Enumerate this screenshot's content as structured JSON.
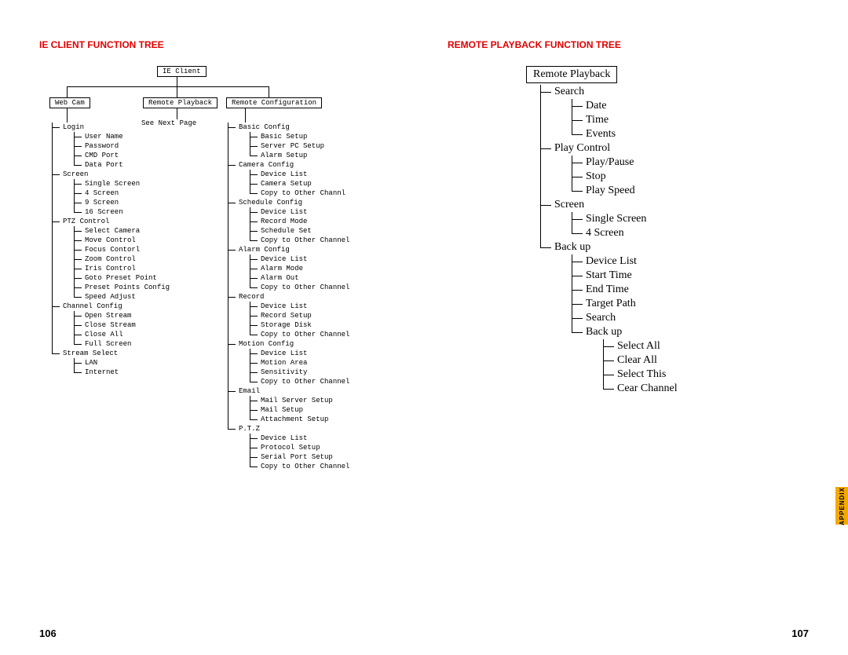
{
  "page_left": {
    "heading": "Ie Client Function Tree",
    "page_number": "106",
    "root": "IE Client",
    "branches": {
      "webcam": "Web Cam",
      "remote_playback": "Remote Playback",
      "remote_configuration": "Remote Configuration"
    },
    "see_next": "See Next Page",
    "webcam_tree": {
      "login": {
        "label": "Login",
        "children": [
          "User Name",
          "Password",
          "CMD Port",
          "Data Port"
        ]
      },
      "screen": {
        "label": "Screen",
        "children": [
          "Single Screen",
          "4 Screen",
          "9 Screen",
          "16 Screen"
        ]
      },
      "ptz": {
        "label": "PTZ Control",
        "children": [
          "Select Camera",
          "Move Control",
          "Focus Contorl",
          "Zoom Control",
          "Iris Control",
          "Goto Preset Point",
          "Preset Points Config",
          "Speed Adjust"
        ]
      },
      "channel": {
        "label": "Channel Config",
        "children": [
          "Open Stream",
          "Close Stream",
          "Close All",
          "Full Screen"
        ]
      },
      "stream": {
        "label": "Stream Select",
        "children": [
          "LAN",
          "Internet"
        ]
      }
    },
    "config_tree": {
      "basic": {
        "label": "Basic Config",
        "children": [
          "Basic Setup",
          "Server PC Setup",
          "Alarm Setup"
        ]
      },
      "camera": {
        "label": "Camera Config",
        "children": [
          "Device List",
          "Camera Setup",
          "Copy to Other Channl"
        ]
      },
      "schedule": {
        "label": "Schedule Config",
        "children": [
          "Device List",
          "Record Mode",
          "Schedule Set",
          "Copy to Other Channel"
        ]
      },
      "alarm": {
        "label": "Alarm Config",
        "children": [
          "Device List",
          "Alarm Mode",
          "Alarm Out",
          "Copy to Other Channel"
        ]
      },
      "record": {
        "label": "Record",
        "children": [
          "Device List",
          "Record Setup",
          "Storage Disk",
          "Copy to Other Channel"
        ]
      },
      "motion": {
        "label": "Motion Config",
        "children": [
          "Device List",
          "Motion Area",
          "Sensitivity",
          "Copy to Other Channel"
        ]
      },
      "email": {
        "label": "Email",
        "children": [
          "Mail Server Setup",
          "Mail Setup",
          "Attachment Setup"
        ]
      },
      "ptz": {
        "label": "P.T.Z",
        "children": [
          "Device List",
          "Protocol Setup",
          "Serial Port Setup",
          "Copy to Other Channel"
        ]
      }
    }
  },
  "page_right": {
    "heading": "Remote Playback Function Tree",
    "page_number": "107",
    "appendix_label": "Appendix",
    "root": "Remote Playback",
    "tree": [
      {
        "label": "Search",
        "children": [
          {
            "label": "Date"
          },
          {
            "label": "Time"
          },
          {
            "label": "Events"
          }
        ]
      },
      {
        "label": "Play Control",
        "children": [
          {
            "label": "Play/Pause"
          },
          {
            "label": "Stop"
          },
          {
            "label": "Play Speed"
          }
        ]
      },
      {
        "label": "Screen",
        "children": [
          {
            "label": "Single Screen"
          },
          {
            "label": "4 Screen"
          }
        ]
      },
      {
        "label": "Back up",
        "children": [
          {
            "label": "Device List"
          },
          {
            "label": "Start Time"
          },
          {
            "label": "End Time"
          },
          {
            "label": "Target Path"
          },
          {
            "label": "Search"
          },
          {
            "label": "Back up",
            "children": [
              {
                "label": "Select All"
              },
              {
                "label": "Clear All"
              },
              {
                "label": "Select This"
              },
              {
                "label": "Cear Channel"
              }
            ]
          }
        ]
      }
    ]
  }
}
